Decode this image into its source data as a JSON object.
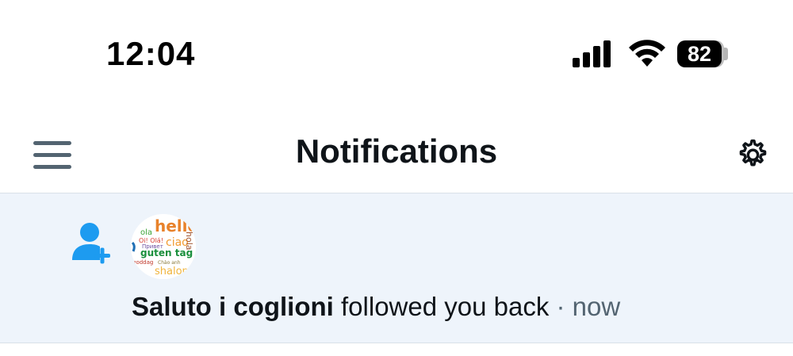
{
  "status_bar": {
    "time": "12:04",
    "battery_level": "82",
    "icons": [
      "cellular-signal-icon",
      "wifi-icon",
      "battery-icon"
    ]
  },
  "header": {
    "title": "Notifications",
    "icons": [
      "hamburger-menu-icon",
      "settings-gear-icon"
    ]
  },
  "notifications": [
    {
      "type_icon": "user-plus-icon",
      "user_name": "Saluto i coglioni",
      "action_text": " followed you back",
      "separator": " · ",
      "time": "now",
      "avatar_words": [
        "hello",
        "ola",
        "Oi! Olá!",
        "Привет",
        "ciao",
        "hola",
        "guten tag",
        "shalom",
        "goddag",
        "Chào anh"
      ]
    }
  ],
  "colors": {
    "accent": "#1d9bf0",
    "icon_gray": "#536471",
    "notification_bg": "#eef4fb",
    "text": "#0f1419"
  }
}
